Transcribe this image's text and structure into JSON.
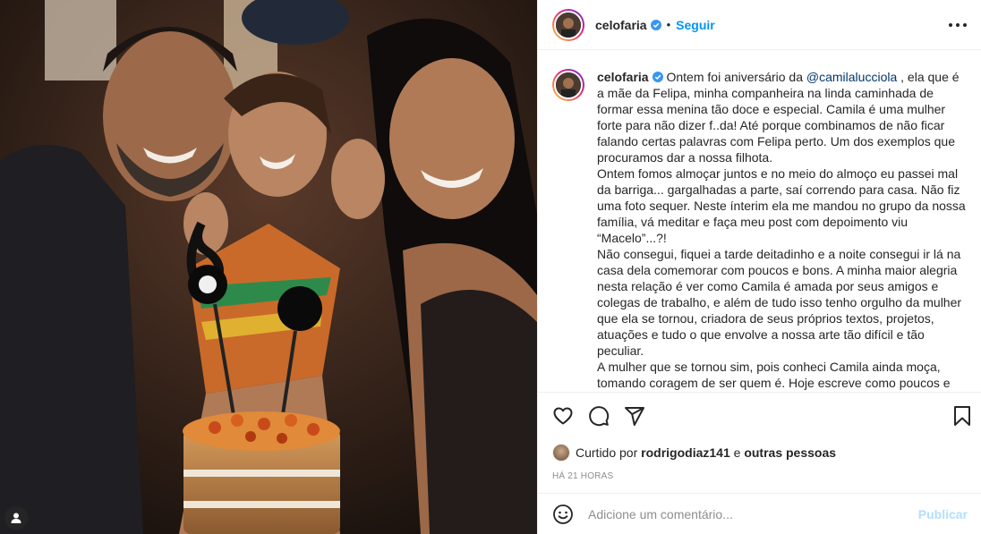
{
  "post": {
    "username": "celofaria",
    "dot": "•",
    "follow_label": "Seguir"
  },
  "caption": {
    "username": "celofaria",
    "intro": " Ontem foi aniversário da ",
    "mention": "@camilalucciola",
    "after_mention": " , ela que é a mãe da Felipa, minha companheira na linda caminhada de formar essa menina tão doce e especial. Camila é uma mulher forte para não dizer f..da! Até porque combinamos de não ficar falando certas palavras com Felipa perto. Um dos exemplos que procuramos dar a nossa filhota.",
    "para2": "Ontem fomos almoçar juntos e no meio do almoço eu passei mal da barriga... gargalhadas a parte, saí correndo para casa. Não fiz uma foto sequer. Neste ínterim ela me mandou no grupo da nossa família, vá meditar e faça meu post com depoimento viu “Macelo”...?!",
    "para3": "Não consegui, fiquei a tarde deitadinho e a noite consegui ir lá na casa dela comemorar com poucos e bons. A minha maior alegria nesta relação é ver como Camila é amada por seus amigos e colegas de trabalho, e além de tudo isso tenho orgulho da mulher que ela se tornou, criadora de seus próprios textos, projetos, atuações e tudo o que envolve a nossa arte tão difícil e tão peculiar.",
    "para4": "A mulher que se tornou sim, pois conheci Camila ainda moça, tomando coragem de ser quem é. Hoje escreve como poucos e atua com a alma. Agora é ela quem escreverá para eu atuar !"
  },
  "likes": {
    "prefix": "Curtido por ",
    "user": "rodrigodiaz141",
    "middle": " e ",
    "others": "outras pessoas"
  },
  "timestamp": "HÁ 21 HORAS",
  "comment": {
    "placeholder": "Adicione um comentário...",
    "publish_label": "Publicar"
  },
  "icons": {
    "verified": "verified-badge-icon",
    "more": "more-options-icon",
    "like": "heart-icon",
    "comment": "comment-icon",
    "share": "share-icon",
    "save": "bookmark-icon",
    "emoji": "emoji-icon",
    "tag": "user-tag-icon"
  },
  "colors": {
    "accent": "#0095f6",
    "verified": "#3897f0",
    "mention": "#00376b",
    "muted": "#8e8e8e",
    "publish_disabled": "#b2dffc"
  }
}
